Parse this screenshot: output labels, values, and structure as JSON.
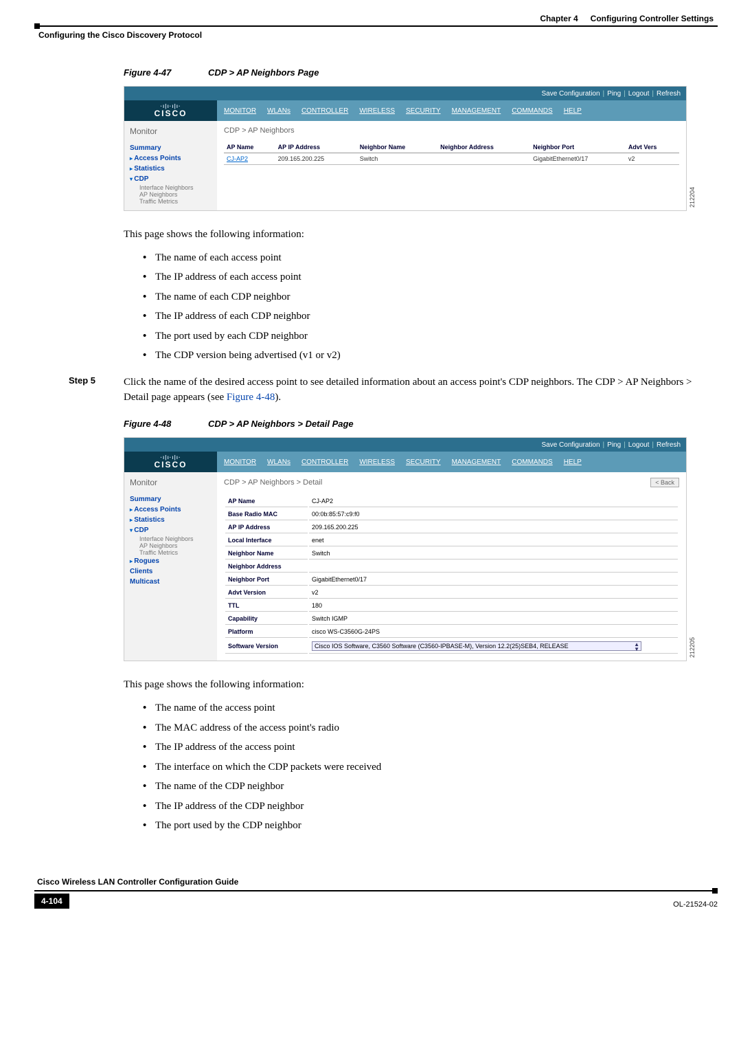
{
  "header": {
    "chapter_label": "Chapter 4",
    "chapter_title": "Configuring Controller Settings",
    "section_title": "Configuring the Cisco Discovery Protocol"
  },
  "fig47": {
    "num": "Figure 4-47",
    "title": "CDP > AP Neighbors Page",
    "imgnum": "212204",
    "toplinks": {
      "save": "Save Configuration",
      "ping": "Ping",
      "logout": "Logout",
      "refresh": "Refresh"
    },
    "logo": "CISCO",
    "menu": [
      "MONITOR",
      "WLANs",
      "CONTROLLER",
      "WIRELESS",
      "SECURITY",
      "MANAGEMENT",
      "COMMANDS",
      "HELP"
    ],
    "side_title": "Monitor",
    "side": {
      "summary": "Summary",
      "ap": "Access Points",
      "stats": "Statistics",
      "cdp": "CDP",
      "sub1": "Interface Neighbors",
      "sub2": "AP Neighbors",
      "sub3": "Traffic Metrics"
    },
    "crumb": "CDP > AP Neighbors",
    "cols": {
      "c1": "AP Name",
      "c2": "AP IP Address",
      "c3": "Neighbor Name",
      "c4": "Neighbor Address",
      "c5": "Neighbor Port",
      "c6": "Advt Vers"
    },
    "row": {
      "c1": "CJ-AP2",
      "c2": "209.165.200.225",
      "c3": "Switch",
      "c4": "",
      "c5": "GigabitEthernet0/17",
      "c6": "v2"
    }
  },
  "text47_intro": "This page shows the following information:",
  "list47": {
    "i1": "The name of each access point",
    "i2": "The IP address of each access point",
    "i3": "The name of each CDP neighbor",
    "i4": "The IP address of each CDP neighbor",
    "i5": "The port used by each CDP neighbor",
    "i6": "The CDP version being advertised (v1 or v2)"
  },
  "step5": {
    "label": "Step 5",
    "text_a": "Click the name of the desired access point to see detailed information about an access point's CDP neighbors. The CDP > AP Neighbors > Detail page appears (see ",
    "xref": "Figure 4-48",
    "text_b": ")."
  },
  "fig48": {
    "num": "Figure 4-48",
    "title": "CDP > AP Neighbors > Detail Page",
    "imgnum": "212205",
    "crumb": "CDP > AP Neighbors  >   Detail",
    "back": "< Back",
    "side_extra": {
      "rogues": "Rogues",
      "clients": "Clients",
      "multicast": "Multicast"
    },
    "kv": {
      "k1": "AP Name",
      "v1": "CJ-AP2",
      "k2": "Base Radio MAC",
      "v2": "00:0b:85:57:c9:f0",
      "k3": "AP IP Address",
      "v3": "209.165.200.225",
      "k4": "Local Interface",
      "v4": "enet",
      "k5": "Neighbor Name",
      "v5": "Switch",
      "k6": "Neighbor Address",
      "v6": "",
      "k7": "Neighbor Port",
      "v7": "GigabitEthernet0/17",
      "k8": "Advt Version",
      "v8": "v2",
      "k9": "TTL",
      "v9": "180",
      "k10": "Capability",
      "v10": "Switch IGMP",
      "k11": "Platform",
      "v11": "cisco WS-C3560G-24PS",
      "k12": "Software Version",
      "v12": "Cisco IOS Software, C3560 Software (C3560-IPBASE-M), Version 12.2(25)SEB4, RELEASE"
    }
  },
  "text48_intro": "This page shows the following information:",
  "list48": {
    "i1": "The name of the access point",
    "i2": "The MAC address of the access point's radio",
    "i3": "The IP address of the access point",
    "i4": "The interface on which the CDP packets were received",
    "i5": "The name of the CDP neighbor",
    "i6": "The IP address of the CDP neighbor",
    "i7": "The port used by the CDP neighbor"
  },
  "footer": {
    "guide": "Cisco Wireless LAN Controller Configuration Guide",
    "page": "4-104",
    "doc": "OL-21524-02"
  }
}
